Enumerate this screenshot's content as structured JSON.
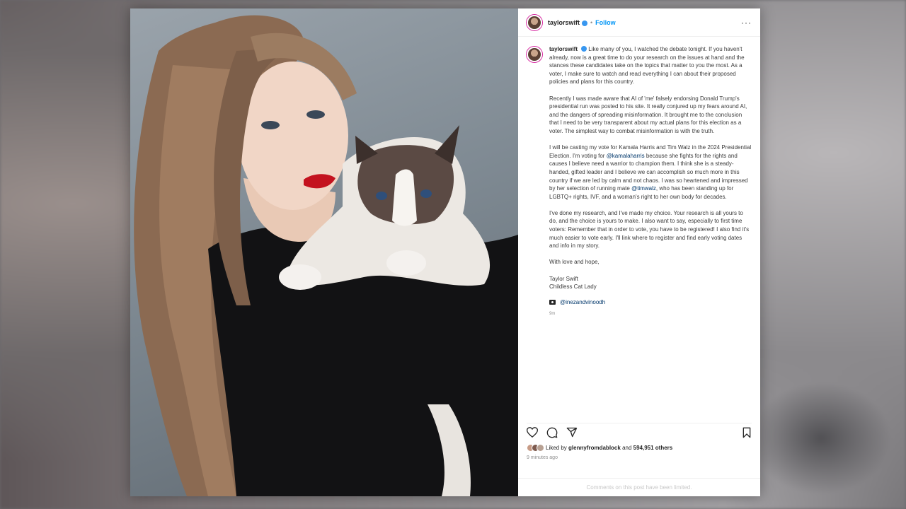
{
  "post": {
    "username": "taylorswift",
    "follow_label": "Follow",
    "separator": "•",
    "more_label": "···",
    "caption_paragraphs": [
      "Like many of you, I watched the debate tonight. If you haven't already, now is a great time to do your research on the issues at hand and the stances these candidates take on the topics that matter to you the most. As a voter, I make sure to watch and read everything I can about their proposed policies and plans for this country.",
      "Recently I was made aware that AI of 'me' falsely endorsing Donald Trump's presidential run was posted to his site. It really conjured up my fears around AI, and the dangers of spreading misinformation. It brought me to the conclusion that I need to be very transparent about my actual plans for this election as a voter. The simplest way to combat misinformation is with the truth.",
      "I will be casting my vote for Kamala Harris and Tim Walz in the 2024 Presidential Election. I'm voting for",
      "I've done my research, and I've made my choice. Your research is all yours to do, and the choice is yours to make. I also want to say, especially to first time voters: Remember that in order to vote, you have to be registered! I also find it's much easier to vote early. I'll link where to register and find early voting dates and info in my story.",
      "With love and hope,"
    ],
    "kamala_mention": "@kamalaharris",
    "para3_mid": "because she fights for the rights and causes I believe need a warrior to champion them. I think she is a steady-handed, gifted leader and I believe we can accomplish so much more in this country if we are led by calm and not chaos. I was so heartened and impressed by her selection of running mate",
    "walz_mention": "@timwalz",
    "para3_end": ", who has been standing up for LGBTQ+ rights, IVF, and a woman's right to her own body for decades.",
    "signature_name": "Taylor Swift",
    "signature_title": "Childless Cat Lady",
    "photo_credit": "@inezandvinoodh",
    "caption_age": "9m",
    "likes_prefix": "Liked by",
    "liked_by_user": "glennyfromdablock",
    "likes_and": "and",
    "likes_others": "594,951 others",
    "posted_time": "9 minutes ago",
    "comments_notice": "Comments on this post have been limited."
  },
  "icons": [
    "heart-icon",
    "comment-icon",
    "share-icon",
    "bookmark-icon",
    "camera-icon",
    "more-icon",
    "verified-badge-icon"
  ],
  "colors": {
    "accent": "#0095f6",
    "verified": "#3897f0",
    "link": "#00376b"
  }
}
